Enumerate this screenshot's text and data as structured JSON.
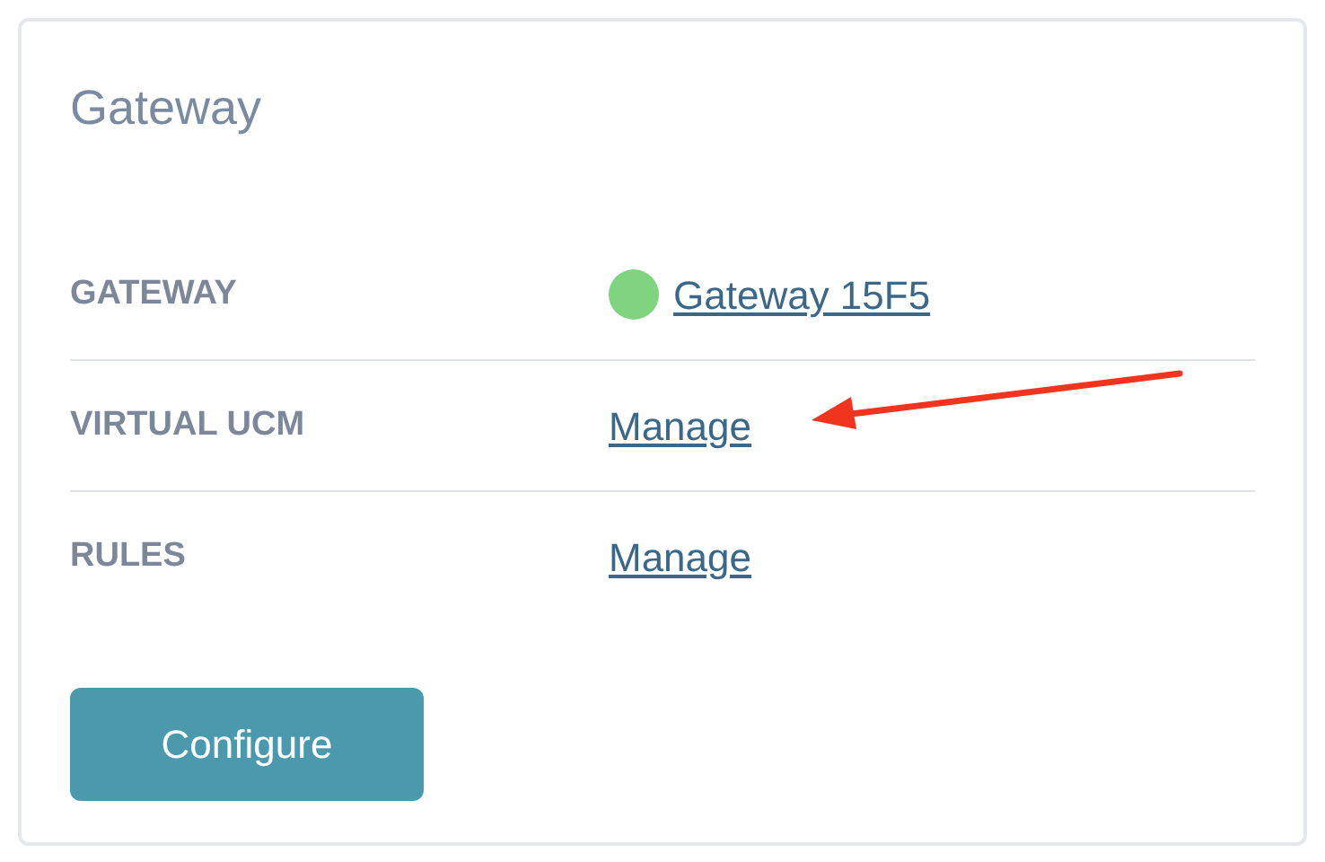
{
  "card": {
    "title": "Gateway",
    "rows": [
      {
        "label": "GATEWAY",
        "kind": "status_link",
        "value": "Gateway 15F5",
        "color": "#80d37f"
      },
      {
        "label": "VIRTUAL UCM",
        "kind": "link",
        "value": "Manage"
      },
      {
        "label": "RULES",
        "kind": "link",
        "value": "Manage"
      }
    ],
    "button": "Configure"
  }
}
